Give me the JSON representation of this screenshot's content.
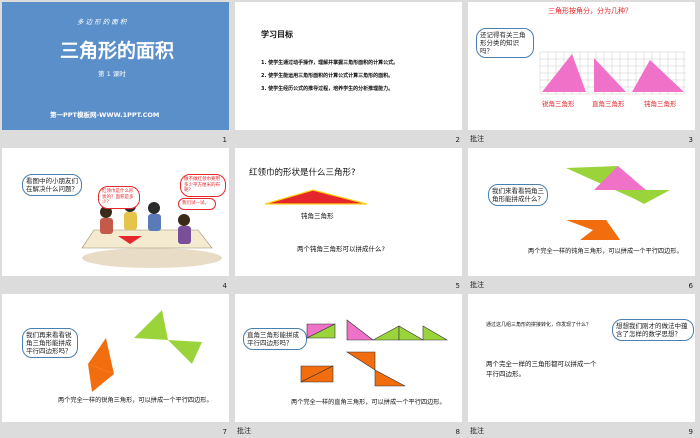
{
  "slides": [
    {
      "num": "1",
      "kicker": "多 边 形 的 面 积",
      "title": "三角形的面积",
      "lesson": "第 1 课时",
      "brand": "第一PPT模板网-WWW.1PPT.COM"
    },
    {
      "num": "2",
      "heading": "学习目标",
      "goals": [
        "1. 使学生通过动手操作，理解并掌握三角形面积的计算公式。",
        "2. 使学生能运用三角形面积的计算公式计算三角形的面积。",
        "3. 使学生经历公式的推导过程，培养学生的分析推理能力。"
      ]
    },
    {
      "num": "3",
      "topic": "三角形按角分，分为几种？",
      "bubble": "还记得有关三角形分类的知识吗？",
      "labels": [
        "锐角三角形",
        "直角三角形",
        "钝角三角形"
      ]
    },
    {
      "num": "4",
      "bubble": "看图中的小朋友们在解决什么问题？",
      "speech1": "红领巾是什么形状的？面积是多少？",
      "speech2": "做不做红领巾要用多少平方厘米的布呢？",
      "speech3": "我们试一试。"
    },
    {
      "num": "5",
      "question": "红领巾的形状是什么三角形?",
      "label": "钝角三角形",
      "caption": "两个钝角三角形可以拼成什么?"
    },
    {
      "num": "6",
      "bubble": "我们来看看钝角三角形能拼成什么？",
      "caption": "两个完全一样的钝角三角形，可以拼成一个平行四边形。"
    },
    {
      "num": "7",
      "bubble": "我们再来看看锐角三角形能拼成平行四边形吗？",
      "caption": "两个完全一样的锐角三角形，可以拼成一个平行四边形。"
    },
    {
      "num": "8",
      "bubble": "直角三角形能拼成平行四边形吗？",
      "caption": "两个完全一样的直角三角形，可以拼成一个平行四边形。"
    },
    {
      "num": "9",
      "top": "通过这几组三角形的拼接转化，你发现了什么？",
      "bubble": "想想我们刚才的做法中蕴含了怎样的数学思想？",
      "caption": "两个完全一样的三角形都可以拼成一个平行四边形。"
    }
  ],
  "annotation": "批注",
  "colors": {
    "blue": "#5b8fc9",
    "pink": "#f071c8",
    "green": "#9bd43a",
    "orange": "#f26d0e",
    "red": "#e5262a",
    "yellow": "#ffd21a"
  }
}
